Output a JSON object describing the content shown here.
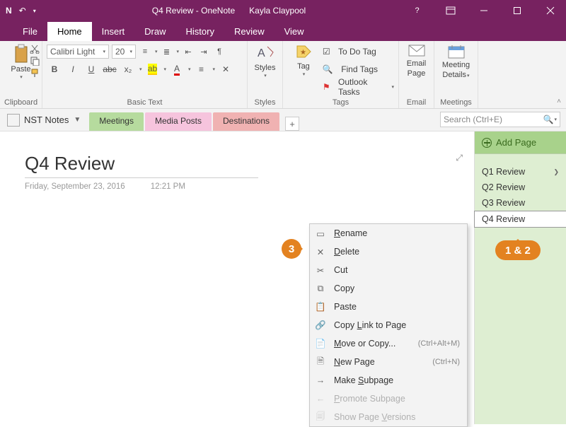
{
  "window": {
    "title": "Q4 Review - OneNote",
    "user": "Kayla Claypool"
  },
  "menu": {
    "file": "File",
    "tabs": [
      "Home",
      "Insert",
      "Draw",
      "History",
      "Review",
      "View"
    ],
    "active": "Home"
  },
  "ribbon": {
    "clipboard": {
      "paste": "Paste",
      "label": "Clipboard"
    },
    "basictext": {
      "font": "Calibri Light",
      "size": "20",
      "label": "Basic Text"
    },
    "styles": {
      "btn": "Styles",
      "label": "Styles"
    },
    "tags": {
      "tag": "Tag",
      "todo": "To Do Tag",
      "find": "Find Tags",
      "outlook": "Outlook Tasks",
      "label": "Tags"
    },
    "email": {
      "btn_l1": "Email",
      "btn_l2": "Page",
      "label": "Email"
    },
    "meetings": {
      "btn_l1": "Meeting",
      "btn_l2": "Details",
      "label": "Meetings"
    }
  },
  "notebook": {
    "name": "NST Notes",
    "sections": [
      {
        "label": "Meetings",
        "style": "green"
      },
      {
        "label": "Media Posts",
        "style": "pink1"
      },
      {
        "label": "Destinations",
        "style": "pink2"
      }
    ],
    "search_placeholder": "Search (Ctrl+E)"
  },
  "page": {
    "title": "Q4 Review",
    "date": "Friday, September 23, 2016",
    "time": "12:21 PM"
  },
  "pagepanel": {
    "add": "Add Page",
    "items": [
      "Q1 Review",
      "Q2 Review",
      "Q3 Review",
      "Q4 Review"
    ],
    "selected": "Q4 Review"
  },
  "context_menu": {
    "rename": "Rename",
    "delete": "Delete",
    "cut": "Cut",
    "copy": "Copy",
    "paste": "Paste",
    "copylink": "Copy Link to Page",
    "move": "Move or Copy...",
    "move_sc": "(Ctrl+Alt+M)",
    "newpage": "New Page",
    "newpage_sc": "(Ctrl+N)",
    "subpage": "Make Subpage",
    "promote": "Promote Subpage",
    "versions": "Show Page Versions"
  },
  "annotations": {
    "badge3": "3",
    "badge12": "1 & 2"
  }
}
